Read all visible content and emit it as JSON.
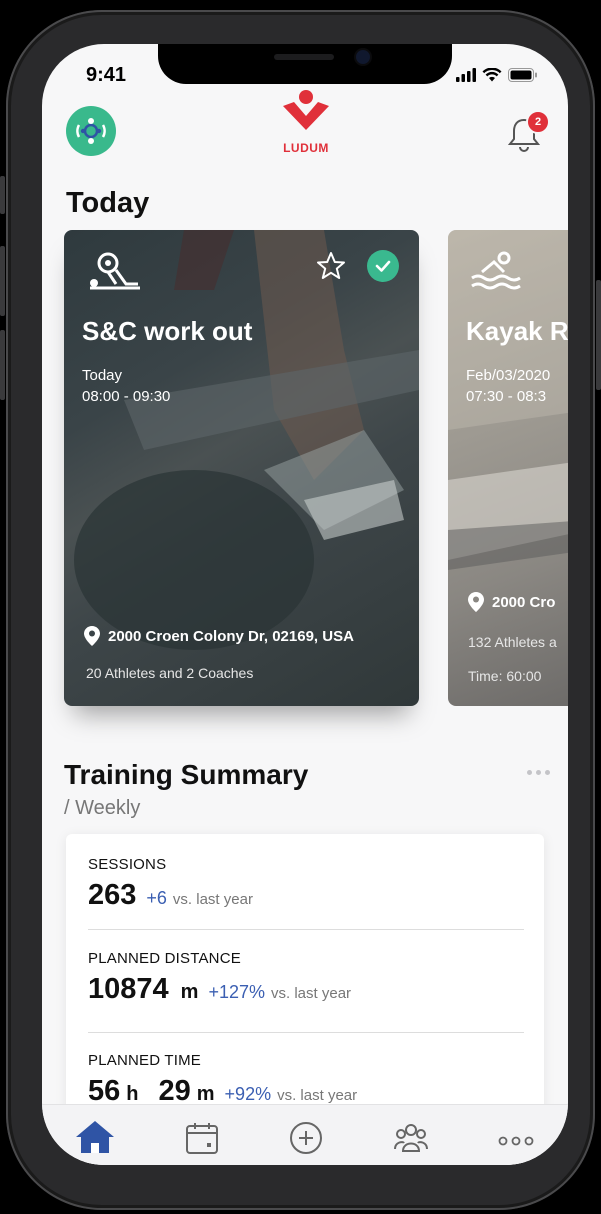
{
  "status": {
    "time": "9:41"
  },
  "header": {
    "brand": "LUDUM",
    "notification_count": "2",
    "accent": "#e0303a",
    "avatar_color": "#39b98c"
  },
  "today": {
    "title": "Today",
    "cards": [
      {
        "title": "S&C work out",
        "date": "Today",
        "time": "08:00 - 09:30",
        "address": "2000 Croen Colony Dr, 02169, USA",
        "athletes": "20 Athletes and 2 Coaches",
        "sport_icon": "weightlifting-icon",
        "starred": false,
        "completed": true
      },
      {
        "title": "Kayak R",
        "date": "Feb/03/2020",
        "time": "07:30 - 08:3",
        "address": "2000 Cro",
        "athletes": "132 Athletes a",
        "duration": "Time: 60:00",
        "sport_icon": "swimming-icon"
      }
    ]
  },
  "training_summary": {
    "title": "Training Summary",
    "subtitle": "/ Weekly",
    "stats": [
      {
        "label": "SESSIONS",
        "value": "263",
        "delta": "+6",
        "vs": "vs. last year"
      },
      {
        "label": "PLANNED DISTANCE",
        "value": "10874",
        "unit": "m",
        "delta": "+127%",
        "vs": "vs. last year"
      },
      {
        "label": "PLANNED TIME",
        "hours": "56",
        "hours_unit": "h",
        "minutes": "29",
        "minutes_unit": "m",
        "delta": "+92%",
        "vs": "vs. last year"
      }
    ]
  },
  "tabbar": {
    "items": [
      "home-icon",
      "calendar-icon",
      "add-icon",
      "team-icon",
      "more-icon"
    ],
    "active": "home-icon",
    "active_color": "#2f54a5"
  }
}
